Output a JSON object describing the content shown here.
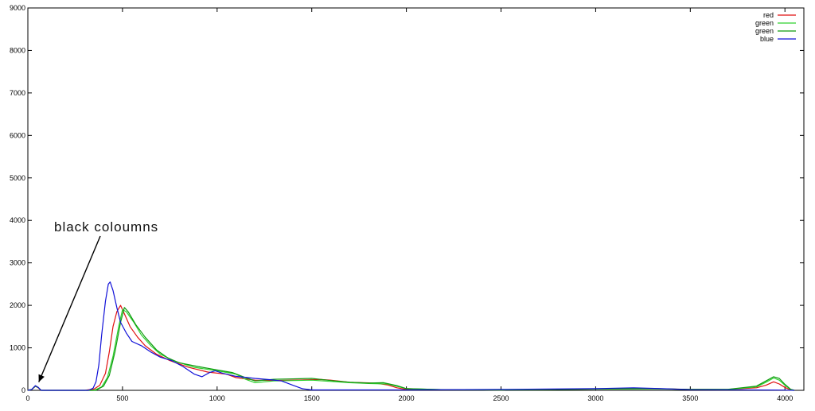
{
  "chart_data": {
    "type": "line",
    "title": "",
    "xlabel": "",
    "ylabel": "",
    "xlim": [
      0,
      4100
    ],
    "ylim": [
      0,
      9000
    ],
    "grid": false,
    "legend_position": "top-right",
    "x_ticks": [
      0,
      500,
      1000,
      1500,
      2000,
      2500,
      3000,
      3500,
      4000
    ],
    "y_ticks": [
      0,
      1000,
      2000,
      3000,
      4000,
      5000,
      6000,
      7000,
      8000,
      9000
    ],
    "annotation": {
      "text": "black coloumns",
      "target": {
        "x": 45,
        "y": 120
      },
      "text_anchor": {
        "x": 130,
        "y": 3850
      }
    },
    "series": [
      {
        "name": "red",
        "color": "#e01010",
        "points": [
          [
            0,
            0
          ],
          [
            20,
            20
          ],
          [
            40,
            95
          ],
          [
            55,
            60
          ],
          [
            70,
            0
          ],
          [
            300,
            0
          ],
          [
            350,
            30
          ],
          [
            380,
            120
          ],
          [
            410,
            400
          ],
          [
            430,
            900
          ],
          [
            450,
            1500
          ],
          [
            470,
            1850
          ],
          [
            490,
            2000
          ],
          [
            510,
            1800
          ],
          [
            540,
            1500
          ],
          [
            580,
            1250
          ],
          [
            620,
            1050
          ],
          [
            680,
            850
          ],
          [
            750,
            700
          ],
          [
            850,
            540
          ],
          [
            950,
            430
          ],
          [
            1050,
            380
          ],
          [
            1100,
            300
          ],
          [
            1200,
            240
          ],
          [
            1300,
            230
          ],
          [
            1400,
            240
          ],
          [
            1500,
            250
          ],
          [
            1550,
            255
          ],
          [
            1600,
            240
          ],
          [
            1700,
            190
          ],
          [
            1800,
            175
          ],
          [
            1850,
            160
          ],
          [
            1900,
            130
          ],
          [
            1950,
            60
          ],
          [
            2000,
            20
          ],
          [
            2200,
            15
          ],
          [
            2500,
            10
          ],
          [
            2800,
            20
          ],
          [
            3000,
            30
          ],
          [
            3300,
            40
          ],
          [
            3500,
            20
          ],
          [
            3700,
            20
          ],
          [
            3850,
            60
          ],
          [
            3900,
            120
          ],
          [
            3940,
            200
          ],
          [
            3970,
            150
          ],
          [
            4000,
            70
          ],
          [
            4030,
            10
          ],
          [
            4050,
            0
          ]
        ]
      },
      {
        "name": "green",
        "color": "#2ed02e",
        "points": [
          [
            0,
            0
          ],
          [
            20,
            20
          ],
          [
            40,
            100
          ],
          [
            55,
            65
          ],
          [
            70,
            0
          ],
          [
            350,
            0
          ],
          [
            390,
            80
          ],
          [
            420,
            300
          ],
          [
            450,
            800
          ],
          [
            480,
            1500
          ],
          [
            500,
            1900
          ],
          [
            520,
            1850
          ],
          [
            560,
            1600
          ],
          [
            600,
            1300
          ],
          [
            650,
            1050
          ],
          [
            700,
            850
          ],
          [
            780,
            680
          ],
          [
            880,
            540
          ],
          [
            1000,
            460
          ],
          [
            1100,
            380
          ],
          [
            1150,
            260
          ],
          [
            1200,
            180
          ],
          [
            1300,
            220
          ],
          [
            1400,
            230
          ],
          [
            1500,
            240
          ],
          [
            1600,
            210
          ],
          [
            1700,
            180
          ],
          [
            1800,
            160
          ],
          [
            1900,
            150
          ],
          [
            2000,
            40
          ],
          [
            2200,
            15
          ],
          [
            2500,
            10
          ],
          [
            2800,
            20
          ],
          [
            3000,
            30
          ],
          [
            3300,
            35
          ],
          [
            3500,
            20
          ],
          [
            3700,
            20
          ],
          [
            3850,
            80
          ],
          [
            3900,
            190
          ],
          [
            3940,
            290
          ],
          [
            3970,
            240
          ],
          [
            4000,
            120
          ],
          [
            4030,
            20
          ],
          [
            4050,
            0
          ]
        ]
      },
      {
        "name": "green",
        "color": "#0f9a0f",
        "points": [
          [
            0,
            0
          ],
          [
            20,
            20
          ],
          [
            40,
            100
          ],
          [
            55,
            65
          ],
          [
            70,
            0
          ],
          [
            360,
            0
          ],
          [
            400,
            100
          ],
          [
            430,
            350
          ],
          [
            460,
            900
          ],
          [
            490,
            1600
          ],
          [
            510,
            1950
          ],
          [
            530,
            1850
          ],
          [
            570,
            1550
          ],
          [
            620,
            1250
          ],
          [
            680,
            950
          ],
          [
            740,
            760
          ],
          [
            800,
            650
          ],
          [
            900,
            560
          ],
          [
            1000,
            480
          ],
          [
            1080,
            420
          ],
          [
            1150,
            300
          ],
          [
            1200,
            220
          ],
          [
            1300,
            260
          ],
          [
            1400,
            270
          ],
          [
            1500,
            280
          ],
          [
            1600,
            230
          ],
          [
            1700,
            190
          ],
          [
            1800,
            170
          ],
          [
            1880,
            180
          ],
          [
            1950,
            110
          ],
          [
            2000,
            40
          ],
          [
            2200,
            15
          ],
          [
            2500,
            10
          ],
          [
            2800,
            20
          ],
          [
            3000,
            30
          ],
          [
            3300,
            40
          ],
          [
            3500,
            20
          ],
          [
            3700,
            25
          ],
          [
            3850,
            100
          ],
          [
            3900,
            220
          ],
          [
            3940,
            320
          ],
          [
            3970,
            280
          ],
          [
            4000,
            140
          ],
          [
            4030,
            25
          ],
          [
            4050,
            0
          ]
        ]
      },
      {
        "name": "blue",
        "color": "#1010d8",
        "points": [
          [
            0,
            0
          ],
          [
            20,
            20
          ],
          [
            40,
            110
          ],
          [
            55,
            70
          ],
          [
            70,
            0
          ],
          [
            320,
            0
          ],
          [
            345,
            50
          ],
          [
            360,
            200
          ],
          [
            375,
            600
          ],
          [
            390,
            1300
          ],
          [
            410,
            2100
          ],
          [
            425,
            2500
          ],
          [
            435,
            2550
          ],
          [
            450,
            2350
          ],
          [
            470,
            1950
          ],
          [
            490,
            1600
          ],
          [
            520,
            1350
          ],
          [
            550,
            1150
          ],
          [
            600,
            1050
          ],
          [
            650,
            900
          ],
          [
            700,
            780
          ],
          [
            760,
            700
          ],
          [
            820,
            560
          ],
          [
            880,
            380
          ],
          [
            920,
            320
          ],
          [
            960,
            420
          ],
          [
            990,
            460
          ],
          [
            1030,
            400
          ],
          [
            1100,
            330
          ],
          [
            1200,
            280
          ],
          [
            1280,
            250
          ],
          [
            1340,
            220
          ],
          [
            1400,
            120
          ],
          [
            1450,
            40
          ],
          [
            1500,
            10
          ],
          [
            1700,
            10
          ],
          [
            2000,
            10
          ],
          [
            2500,
            20
          ],
          [
            3000,
            40
          ],
          [
            3200,
            60
          ],
          [
            3350,
            40
          ],
          [
            3500,
            15
          ],
          [
            3800,
            10
          ],
          [
            4000,
            5
          ],
          [
            4050,
            0
          ]
        ]
      }
    ]
  }
}
